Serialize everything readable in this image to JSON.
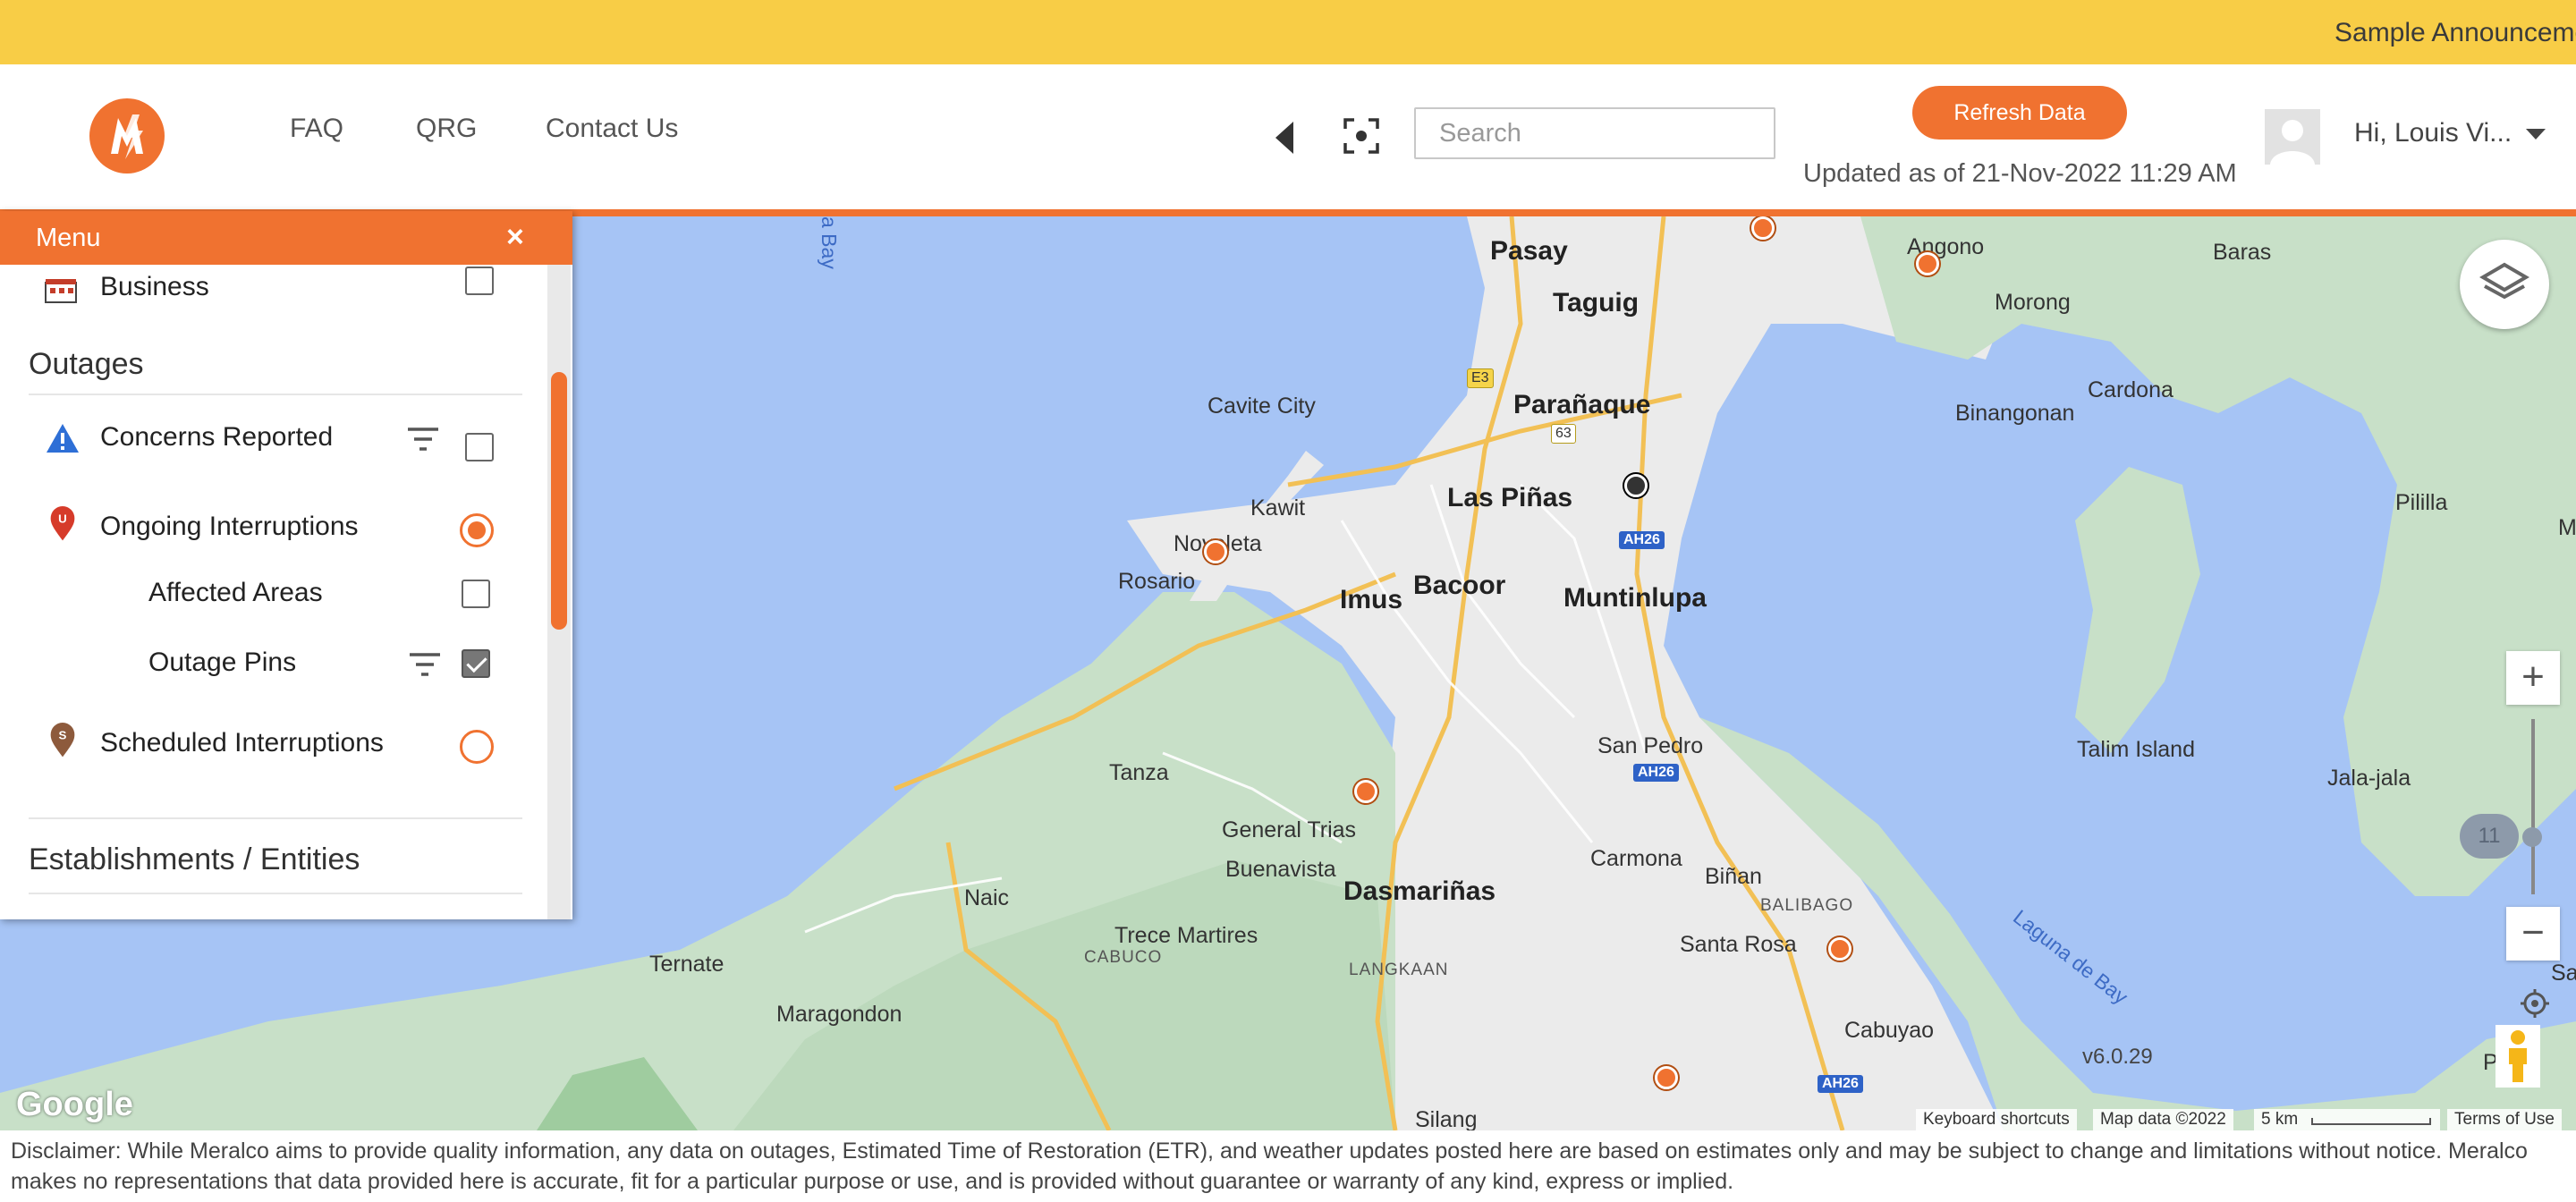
{
  "announcement": "Sample Announcement",
  "header": {
    "nav": [
      "FAQ",
      "QRG",
      "Contact Us"
    ],
    "search_placeholder": "Search",
    "refresh_label": "Refresh Data",
    "updated_text": "Updated as of 21-Nov-2022 11:29 AM",
    "greeting": "Hi, Louis Vi..."
  },
  "menu": {
    "title": "Menu",
    "close_symbol": "×",
    "business_label": "Business",
    "business_checked": false,
    "outages_title": "Outages",
    "concerns_label": "Concerns Reported",
    "concerns_checked": false,
    "ongoing_label": "Ongoing Interruptions",
    "ongoing_selected": true,
    "affected_label": "Affected Areas",
    "affected_checked": false,
    "outage_pins_label": "Outage Pins",
    "outage_pins_checked": true,
    "scheduled_label": "Scheduled Interruptions",
    "scheduled_selected": false,
    "establishments_title": "Establishments / Entities",
    "ongoing_icon_letter": "U",
    "scheduled_icon_letter": "S"
  },
  "map": {
    "places_big": [
      "Pasay",
      "Taguig",
      "Parañaque",
      "Las Piñas",
      "Bacoor",
      "Imus",
      "Muntinlupa",
      "Dasmariñas"
    ],
    "places_med": [
      "Angono",
      "Baras",
      "Morong",
      "Cardona",
      "Binangonan",
      "Pililla",
      "Cavite City",
      "Kawit",
      "Noveleta",
      "Rosario",
      "Tanza",
      "General Trias",
      "Buenavista",
      "San Pedro",
      "Talim Island",
      "Jala-jala",
      "Carmona",
      "Biñan",
      "Santa Rosa",
      "Naic",
      "Trece Martires",
      "Ternate",
      "Maragondon",
      "Cabuyao",
      "Silang",
      "Pila",
      "M",
      "Sa"
    ],
    "places_small": [
      "CABUCO",
      "LANGKAAN",
      "BALIBAGO"
    ],
    "water_labels": [
      "Laguna de Bay",
      "a Bay"
    ],
    "shields": [
      "E3",
      "63",
      "AH26",
      "AH26",
      "AH26"
    ],
    "zoom_level": "11",
    "zoom_in": "+",
    "zoom_out": "−",
    "version": "v6.0.29",
    "google": "Google",
    "attribution": [
      "Keyboard shortcuts",
      "Map data ©2022",
      "5 km",
      "Terms of Use"
    ]
  },
  "disclaimer": "Disclaimer: While Meralco aims to provide quality information, any data on outages, Estimated Time of Restoration (ETR), and weather updates posted here are based on estimates only and may be subject to change and limitations without notice. Meralco makes no representations that data provided here is accurate, fit for a particular purpose or use, and is provided without guarantee or warranty of any kind, express or implied.",
  "colors": {
    "accent": "#f07230",
    "announcement_bg": "#f8cd46",
    "water": "#a6c4f5",
    "land": "#c8e0c8",
    "urban": "#ebebeb"
  }
}
